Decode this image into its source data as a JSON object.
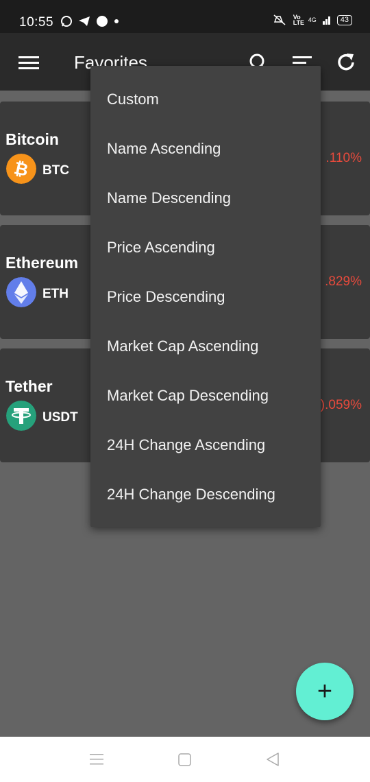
{
  "status_bar": {
    "time": "10:55",
    "battery": "43",
    "network": "4G",
    "volte": "Vo LTE"
  },
  "app_bar": {
    "title": "Favorites",
    "icons": [
      "menu-icon",
      "search-icon",
      "sort-icon",
      "refresh-icon"
    ]
  },
  "coins": [
    {
      "name": "Bitcoin",
      "symbol": "BTC",
      "change": ".110%",
      "icon": "bitcoin-icon",
      "color": "#f7931a"
    },
    {
      "name": "Ethereum",
      "symbol": "ETH",
      "change": ".829%",
      "icon": "ethereum-icon",
      "color": "#627eea"
    },
    {
      "name": "Tether",
      "symbol": "USDT",
      "change": ").059%",
      "icon": "tether-icon",
      "color": "#26a17b"
    }
  ],
  "sort_menu": {
    "items": [
      "Custom",
      "Name Ascending",
      "Name Descending",
      "Price Ascending",
      "Price Descending",
      "Market Cap Ascending",
      "Market Cap Descending",
      "24H Change Ascending",
      "24H Change Descending"
    ]
  },
  "fab": {
    "label": "+"
  },
  "colors": {
    "negative": "#e84a3c",
    "accent": "#62efd3"
  }
}
